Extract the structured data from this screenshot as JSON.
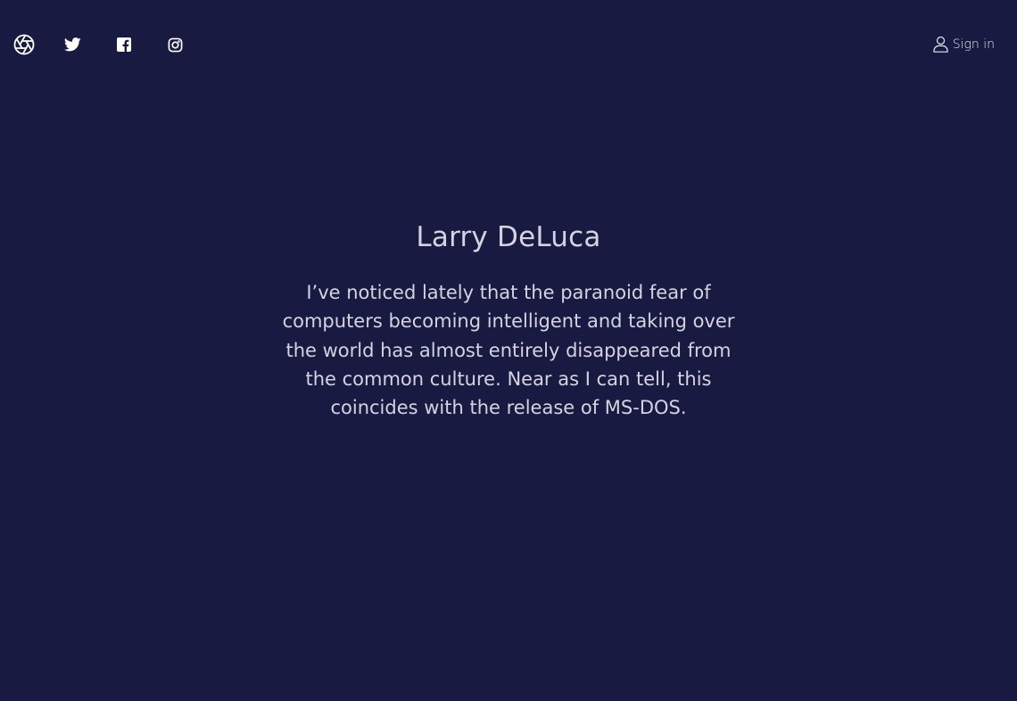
{
  "nav": {
    "logo_icon": "aperture-icon",
    "social": [
      {
        "icon": "twitter-icon"
      },
      {
        "icon": "facebook-icon"
      },
      {
        "icon": "instagram-icon"
      }
    ],
    "signin_label": "Sign in",
    "signin_icon": "user-icon"
  },
  "hero": {
    "name": "Larry DeLuca",
    "quote": "I’ve noticed lately that the paranoid fear of computers becoming intelligent and taking over the world has almost entirely disappeared from the common culture. Near as I can tell, this coincides with the release of MS-DOS."
  },
  "colors": {
    "background": "#181a41",
    "text": "#d4d3e0",
    "icon": "#ffffff"
  }
}
